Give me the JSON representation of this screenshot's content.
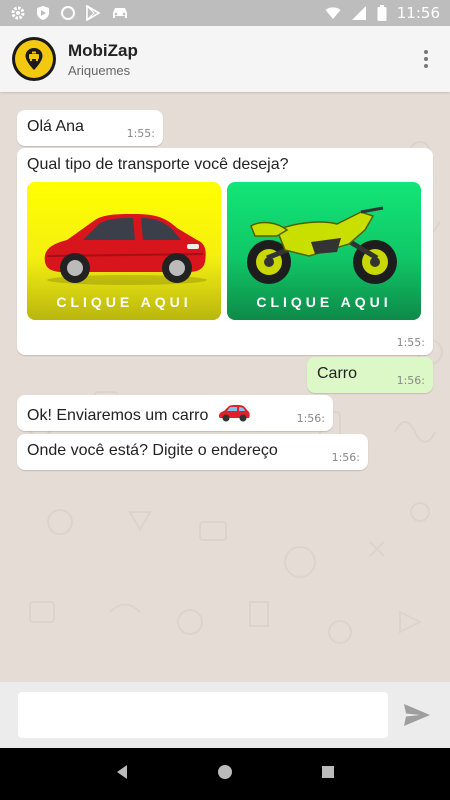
{
  "status_bar": {
    "time": "11:56"
  },
  "header": {
    "title": "MobiZap",
    "subtitle": "Ariquemes"
  },
  "messages": [
    {
      "text": "Olá Ana",
      "time": "1:55:"
    },
    {
      "text": "Qual tipo de transporte você deseja?",
      "time": "1:55:",
      "cards": [
        {
          "label": "CLIQUE AQUI",
          "image": "red-car",
          "color": "#f7f000"
        },
        {
          "label": "CLIQUE AQUI",
          "image": "green-motorcycle",
          "color": "#11d36f"
        }
      ]
    },
    {
      "text": "Carro",
      "time": "1:56:"
    },
    {
      "text": "Ok! Enviaremos um carro",
      "time": "1:56:",
      "emoji": "car-icon"
    },
    {
      "text": "Onde você está? Digite o endereço",
      "time": "1:56:"
    }
  ],
  "input": {
    "value": "",
    "placeholder": ""
  },
  "colors": {
    "chat_bg": "#e5ddd5",
    "outgoing_bubble": "#dcf8c6",
    "incoming_bubble": "#ffffff"
  },
  "icons": [
    "settings-icon",
    "shield-icon",
    "circle-icon",
    "play-store-icon",
    "car-icon",
    "wifi-icon",
    "signal-icon",
    "battery-icon",
    "send-icon",
    "back-icon",
    "home-icon",
    "recents-icon"
  ]
}
